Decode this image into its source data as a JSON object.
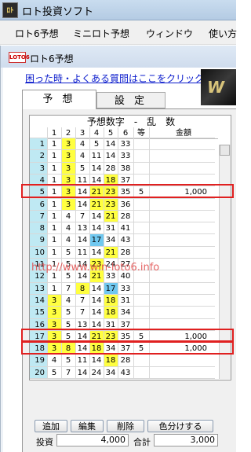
{
  "window": {
    "title": "ロト投資ソフト",
    "icon_text": "ﾛﾄ"
  },
  "menu": [
    "ロト6予想",
    "ミニロト予想",
    "ウィンドウ",
    "使い方"
  ],
  "subwindow": {
    "title": "ロト6予想",
    "icon_text": "LOTO6"
  },
  "faq_link": "困った時・よくある質問はここをクリック",
  "banner_text": "W",
  "tabs": [
    "予 想",
    "設 定"
  ],
  "table": {
    "header_main": "予想数字　-　乱　数",
    "columns": [
      "",
      "1",
      "2",
      "3",
      "4",
      "5",
      "6",
      "等",
      "金額"
    ],
    "rows": [
      {
        "n": "1",
        "nums": [
          "1",
          "3",
          "4",
          "5",
          "14",
          "33"
        ],
        "rank": "",
        "amount": ""
      },
      {
        "n": "2",
        "nums": [
          "1",
          "3",
          "4",
          "11",
          "14",
          "33"
        ],
        "rank": "",
        "amount": ""
      },
      {
        "n": "3",
        "nums": [
          "1",
          "3",
          "5",
          "14",
          "28",
          "38"
        ],
        "rank": "",
        "amount": ""
      },
      {
        "n": "4",
        "nums": [
          "1",
          "3",
          "11",
          "14",
          "18",
          "37"
        ],
        "rank": "",
        "amount": ""
      },
      {
        "n": "5",
        "nums": [
          "1",
          "3",
          "14",
          "21",
          "23",
          "35"
        ],
        "rank": "5",
        "amount": "1,000"
      },
      {
        "n": "6",
        "nums": [
          "1",
          "3",
          "14",
          "21",
          "23",
          "36"
        ],
        "rank": "",
        "amount": ""
      },
      {
        "n": "7",
        "nums": [
          "1",
          "4",
          "7",
          "14",
          "21",
          "28"
        ],
        "rank": "",
        "amount": ""
      },
      {
        "n": "8",
        "nums": [
          "1",
          "4",
          "13",
          "14",
          "31",
          "41"
        ],
        "rank": "",
        "amount": ""
      },
      {
        "n": "9",
        "nums": [
          "1",
          "4",
          "14",
          "17",
          "34",
          "43"
        ],
        "rank": "",
        "amount": ""
      },
      {
        "n": "10",
        "nums": [
          "1",
          "5",
          "11",
          "14",
          "21",
          "28"
        ],
        "rank": "",
        "amount": ""
      },
      {
        "n": "11",
        "nums": [
          "1",
          "5",
          "14",
          "23",
          "24",
          "27"
        ],
        "rank": "",
        "amount": ""
      },
      {
        "n": "12",
        "nums": [
          "1",
          "5",
          "14",
          "21",
          "33",
          "40"
        ],
        "rank": "",
        "amount": ""
      },
      {
        "n": "13",
        "nums": [
          "1",
          "7",
          "8",
          "14",
          "17",
          "33"
        ],
        "rank": "",
        "amount": ""
      },
      {
        "n": "14",
        "nums": [
          "3",
          "4",
          "7",
          "14",
          "18",
          "31"
        ],
        "rank": "",
        "amount": ""
      },
      {
        "n": "15",
        "nums": [
          "3",
          "5",
          "7",
          "14",
          "18",
          "34"
        ],
        "rank": "",
        "amount": ""
      },
      {
        "n": "16",
        "nums": [
          "3",
          "5",
          "13",
          "14",
          "31",
          "37"
        ],
        "rank": "",
        "amount": ""
      },
      {
        "n": "17",
        "nums": [
          "3",
          "5",
          "14",
          "21",
          "23",
          "35"
        ],
        "rank": "5",
        "amount": "1,000"
      },
      {
        "n": "18",
        "nums": [
          "3",
          "8",
          "14",
          "18",
          "34",
          "37"
        ],
        "rank": "5",
        "amount": "1,000"
      },
      {
        "n": "19",
        "nums": [
          "4",
          "5",
          "11",
          "14",
          "18",
          "28"
        ],
        "rank": "",
        "amount": ""
      },
      {
        "n": "20",
        "nums": [
          "5",
          "7",
          "14",
          "24",
          "34",
          "43"
        ],
        "rank": "",
        "amount": ""
      }
    ],
    "highlights": [
      [
        [
          0,
          1
        ],
        [
          1,
          1
        ],
        [
          2,
          1
        ],
        [
          3,
          1
        ],
        [
          3,
          4
        ],
        [
          4,
          1
        ],
        [
          4,
          3
        ],
        [
          4,
          4
        ],
        [
          5,
          1
        ],
        [
          5,
          3
        ],
        [
          5,
          4
        ],
        [
          6,
          4
        ],
        [
          9,
          4
        ],
        [
          10,
          3
        ],
        [
          11,
          3
        ],
        [
          13,
          0
        ],
        [
          13,
          4
        ],
        [
          14,
          0
        ],
        [
          14,
          4
        ],
        [
          15,
          0
        ],
        [
          16,
          0
        ],
        [
          16,
          3
        ],
        [
          16,
          4
        ],
        [
          17,
          0
        ],
        [
          17,
          1
        ],
        [
          17,
          3
        ],
        [
          18,
          4
        ]
      ],
      [
        [
          8,
          3
        ],
        [
          12,
          4
        ]
      ],
      [
        [
          12,
          2
        ]
      ]
    ],
    "highlight_colors": [
      "#ffff40",
      "#70c8f0",
      "#ffff40"
    ],
    "outlined_rows": [
      4,
      16,
      17
    ]
  },
  "watermark": "http://www.win-loto6.info",
  "buttons": [
    "追加",
    "編集",
    "削除",
    "色分けする"
  ],
  "summary": {
    "invest_label": "投資",
    "invest_value": "4,000",
    "total_label": "合計",
    "total_value": "3,000"
  }
}
